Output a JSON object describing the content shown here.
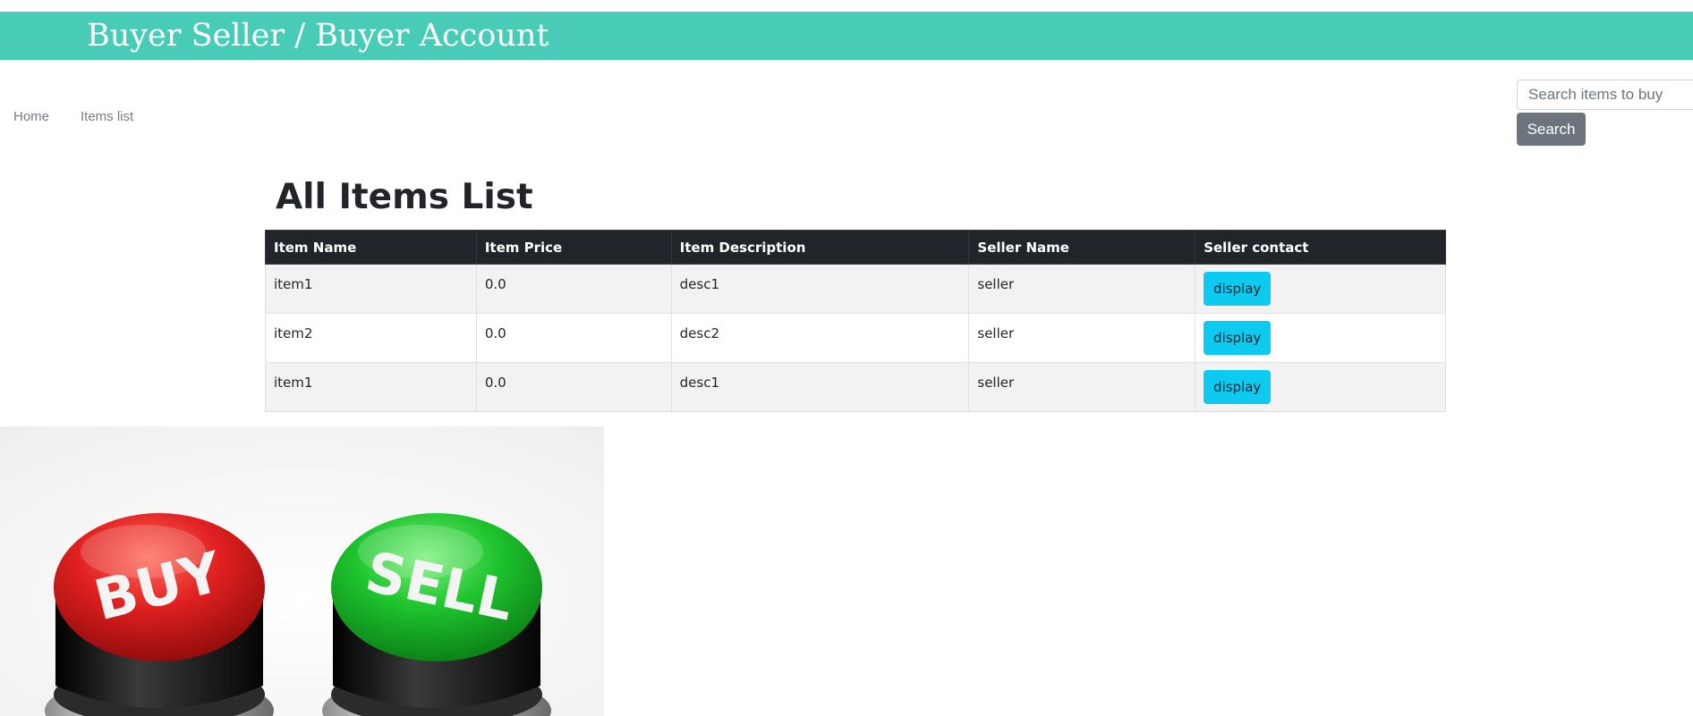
{
  "header": {
    "title": "Buyer Seller / Buyer Account"
  },
  "nav": {
    "items": [
      {
        "label": "Home"
      },
      {
        "label": "Items list"
      }
    ]
  },
  "search": {
    "placeholder": "Search items to buy",
    "value": "",
    "button_label": "Search"
  },
  "main": {
    "heading": "All Items List",
    "table": {
      "columns": [
        "Item Name",
        "Item Price",
        "Item Description",
        "Seller Name",
        "Seller contact"
      ],
      "rows": [
        {
          "name": "item1",
          "price": "0.0",
          "description": "desc1",
          "seller": "seller",
          "action": "display"
        },
        {
          "name": "item2",
          "price": "0.0",
          "description": "desc2",
          "seller": "seller",
          "action": "display"
        },
        {
          "name": "item1",
          "price": "0.0",
          "description": "desc1",
          "seller": "seller",
          "action": "display"
        }
      ]
    }
  },
  "image": {
    "buy_label": "BUY",
    "sell_label": "SELL"
  },
  "colors": {
    "header": "#48ccb8",
    "table_header": "#212529",
    "display_button": "#0dcaf0",
    "search_button": "#6c757d",
    "buy": "#d61f1f",
    "sell": "#1bc32e"
  }
}
